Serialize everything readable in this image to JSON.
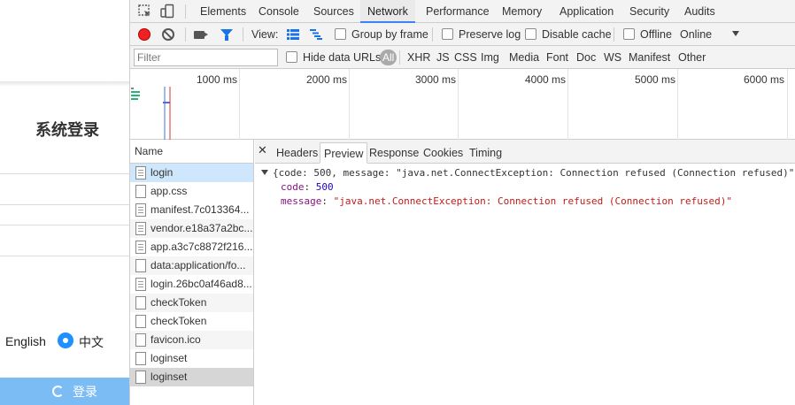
{
  "login": {
    "title": "系统登录",
    "lang_english": "English",
    "lang_chinese": "中文",
    "submit_label": "登录"
  },
  "devtools": {
    "panels": [
      "Elements",
      "Console",
      "Sources",
      "Network",
      "Performance",
      "Memory",
      "Application",
      "Security",
      "Audits"
    ],
    "active_panel": "Network",
    "toolbar": {
      "view_label": "View:",
      "group_by_frame": "Group by frame",
      "preserve_log": "Preserve log",
      "disable_cache": "Disable cache",
      "offline": "Offline",
      "throttle": "Online"
    },
    "filter": {
      "placeholder": "Filter",
      "hide_data_urls": "Hide data URLs",
      "types": [
        "All",
        "XHR",
        "JS",
        "CSS",
        "Img",
        "Media",
        "Font",
        "Doc",
        "WS",
        "Manifest",
        "Other"
      ]
    },
    "timeline_ticks": [
      "1000 ms",
      "2000 ms",
      "3000 ms",
      "4000 ms",
      "5000 ms",
      "6000 ms"
    ],
    "requests": {
      "header": "Name",
      "items": [
        "login",
        "app.css",
        "manifest.7c013364...",
        "vendor.e18a37a2bc...",
        "app.a3c7c8872f216...",
        "data:application/fo...",
        "login.26bc0af46ad8...",
        "checkToken",
        "checkToken",
        "favicon.ico",
        "loginset",
        "loginset"
      ]
    },
    "detail": {
      "tabs": [
        "Headers",
        "Preview",
        "Response",
        "Cookies",
        "Timing"
      ],
      "active_tab": "Preview",
      "preview": {
        "summary": "{code: 500, message: \"java.net.ConnectException: Connection refused (Connection refused)\"}",
        "code_key": "code",
        "code_value": "500",
        "message_key": "message",
        "message_value": "\"java.net.ConnectException: Connection refused (Connection refused)\""
      }
    }
  },
  "colors": {
    "accent": "#3e82f7",
    "record": "#e22222",
    "login_button": "#7cbcf5",
    "radio": "#1e90ff"
  }
}
